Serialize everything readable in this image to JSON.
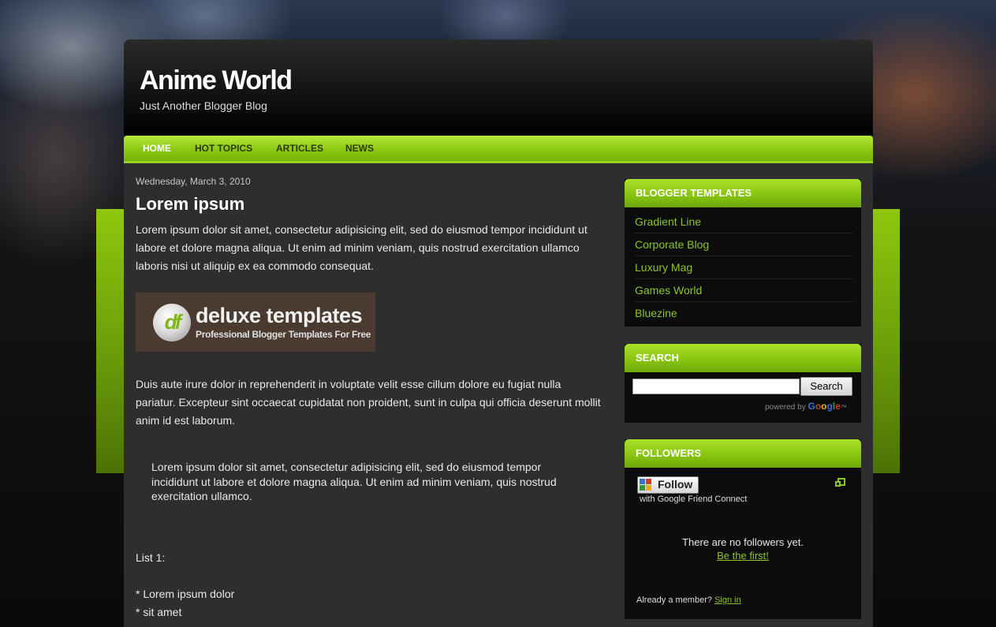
{
  "header": {
    "title": "Anime World",
    "description": "Just Another Blogger Blog"
  },
  "nav": {
    "items": [
      {
        "label": "HOME"
      },
      {
        "label": "HOT TOPICS"
      },
      {
        "label": "ARTICLES"
      },
      {
        "label": "NEWS"
      }
    ]
  },
  "post": {
    "date": "Wednesday, March 3, 2010",
    "title": "Lorem ipsum",
    "paragraph1": "Lorem ipsum dolor sit amet, consectetur adipisicing elit, sed do eiusmod tempor incididunt ut labore et dolore magna aliqua. Ut enim ad minim veniam, quis nostrud exercitation ullamco laboris nisi ut aliquip ex ea commodo consequat.",
    "banner": {
      "logo_letters": "df",
      "title": "deluxe templates",
      "subtitle": "Professional Blogger Templates For Free"
    },
    "paragraph2": "Duis aute irure dolor in reprehenderit in voluptate velit esse cillum dolore eu fugiat nulla pariatur. Excepteur sint occaecat cupidatat non proident, sunt in culpa qui officia deserunt mollit anim id est laborum.",
    "quote": "Lorem ipsum dolor sit amet, consectetur adipisicing elit, sed do eiusmod tempor incididunt ut labore et dolore magna aliqua. Ut enim ad minim veniam, quis nostrud exercitation ullamco.",
    "list_title": "List 1:",
    "list_items": [
      "* Lorem ipsum dolor",
      "* sit amet"
    ]
  },
  "sidebar": {
    "templates": {
      "title": "BLOGGER TEMPLATES",
      "links": [
        "Gradient Line",
        "Corporate Blog",
        "Luxury Mag",
        "Games World",
        "Bluezine"
      ]
    },
    "search": {
      "title": "SEARCH",
      "button_label": "Search",
      "input_value": "",
      "powered_by": "powered by",
      "google": [
        "G",
        "o",
        "o",
        "g",
        "l",
        "e"
      ],
      "google_tm": "™"
    },
    "followers": {
      "title": "FOLLOWERS",
      "follow_label": "Follow",
      "with_gfc": "with Google Friend Connect",
      "no_followers": "There are no followers yet.",
      "be_first": "Be the first!",
      "already_member": "Already a member?",
      "sign_in": "Sign in"
    }
  },
  "colors": {
    "accent_green": "#8cc812",
    "link_green": "#8cc42a",
    "content_bg": "#2e2e2e",
    "widget_bg": "#0c0c0c"
  }
}
